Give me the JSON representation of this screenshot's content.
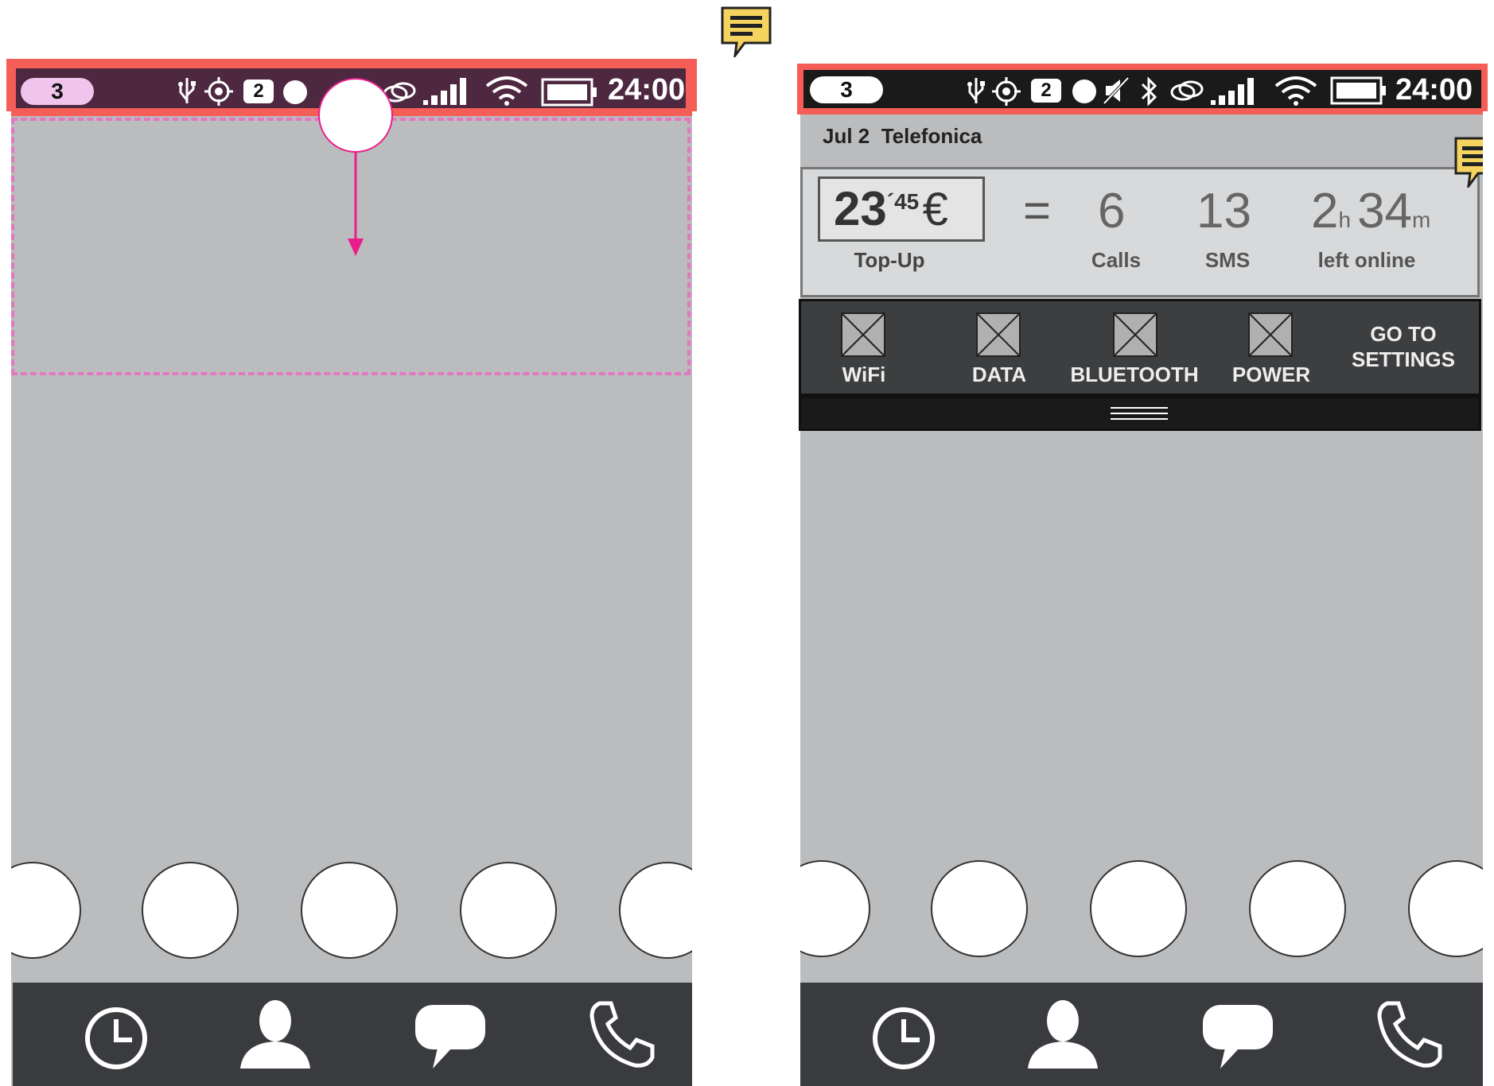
{
  "left_phone": {
    "status": {
      "notification_count": "3",
      "sim_badge": "2",
      "time": "24:00"
    },
    "gesture": "pull-down"
  },
  "right_phone": {
    "status": {
      "notification_count": "3",
      "sim_badge": "2",
      "time": "24:00"
    },
    "date_operator": {
      "date": "Jul 2",
      "operator": "Telefonica"
    },
    "balance": {
      "int": "23",
      "dec": "´45",
      "currency": "€",
      "label": "Top-Up"
    },
    "equals": "=",
    "usage": [
      {
        "value": "6",
        "label": "Calls"
      },
      {
        "value": "13",
        "label": "SMS"
      }
    ],
    "online": {
      "hours": "2",
      "h_unit": "h",
      "minutes": "34",
      "m_unit": "m",
      "label": "left online"
    },
    "quick_settings": [
      {
        "label": "WiFi"
      },
      {
        "label": "DATA"
      },
      {
        "label": "BLUETOOTH"
      },
      {
        "label": "POWER"
      }
    ],
    "settings_link": {
      "line1": "GO TO",
      "line2": "SETTINGS"
    }
  },
  "dock_icons": [
    "clock-icon",
    "contact-icon",
    "message-icon",
    "phone-icon"
  ],
  "colors": {
    "statusbar_frame": "#f45e57",
    "statusbar_left": "#4e2840",
    "statusbar_right": "#1a1a1a",
    "gesture": "#e91e8c",
    "dock": "#393b3e",
    "screen": "#bbbcbe"
  }
}
